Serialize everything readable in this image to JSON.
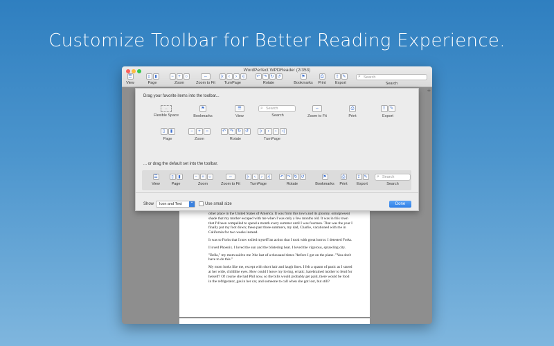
{
  "headline": "Customize Toolbar for Better Reading Experience.",
  "window": {
    "title": "WordPerfect WPDReader (2/353)",
    "toolbar": [
      {
        "label": "View",
        "icons": [
          "view-icon"
        ]
      },
      {
        "label": "Page",
        "icons": [
          "single-page-icon",
          "two-page-icon"
        ]
      },
      {
        "label": "Zoom",
        "icons": [
          "zoom-out-icon",
          "zoom-in-icon",
          "zoom-actual-icon"
        ]
      },
      {
        "label": "Zoom to Fit",
        "icons": [
          "zoom-fit-icon"
        ]
      },
      {
        "label": "TurnPage",
        "icons": [
          "first-page-icon",
          "prev-page-icon",
          "next-page-icon",
          "last-page-icon"
        ]
      },
      {
        "label": "Rotate",
        "icons": [
          "rotate-left-icon",
          "rotate-right-icon",
          "rotate-cw-icon",
          "rotate-ccw-icon"
        ]
      },
      {
        "label": "Bookmarks",
        "icons": [
          "bookmark-icon"
        ]
      },
      {
        "label": "Print",
        "icons": [
          "print-icon"
        ]
      },
      {
        "label": "Export",
        "icons": [
          "export-icon",
          "edit-icon"
        ]
      }
    ],
    "search_placeholder": "Search",
    "search_label": "Search",
    "plus": "+"
  },
  "sheet": {
    "heading": "Drag your favorite items into the toolbar...",
    "palette": [
      {
        "label": "Flexible Space"
      },
      {
        "label": "Bookmarks"
      },
      {
        "label": "View"
      },
      {
        "label": "Search",
        "placeholder": "Search"
      },
      {
        "label": "Zoom to Fit"
      },
      {
        "label": "Print"
      },
      {
        "label": "Export"
      },
      {
        "label": "Page"
      },
      {
        "label": "Zoom"
      },
      {
        "label": "Rotate"
      },
      {
        "label": "TurnPage"
      }
    ],
    "default_heading": "... or drag the default set into the toolbar.",
    "default_set": [
      "View",
      "Page",
      "Zoom",
      "Zoom to Fit",
      "TurnPage",
      "Rotate",
      "Bookmarks",
      "Print",
      "Export",
      "Search"
    ],
    "default_search_placeholder": "Search",
    "show_label": "Show",
    "show_value": "Icon and Text",
    "small_size_label": "Use small size",
    "done_label": "Done"
  },
  "document": {
    "paragraphs": [
      "other place in the United States of America. It was from this town and its gloomy, omnipresent shade that my mother escaped with me when I was only a few months old. It was in this town that I'd been compelled to spend a month every summer until I was fourteen. That was the year I finally put my foot down; these past three summers, my dad, Charlie, vacationed with me in California for two weeks instead.",
      "It was to Forks that I now exiled myself?an action that I took with great horror. I detested Forks.",
      "I loved Phoenix. I loved the sun and the blistering heat. I loved the vigorous, sprawling city.",
      "\"Bella,\" my mom said to me ?the last of a thousand times ?before I got on the plane. \"You don't have to do this.\"",
      "My mom looks like me, except with short hair and laugh lines. I felt a spasm of panic as I stared at her wide, childlike eyes. How could I leave my loving, erratic, harebrained mother to fend for herself? Of course she had Phil now, so the bills would probably get paid, there would be food in the refrigerator, gas in her car, and someone to call when she got lost, but still?"
    ]
  }
}
